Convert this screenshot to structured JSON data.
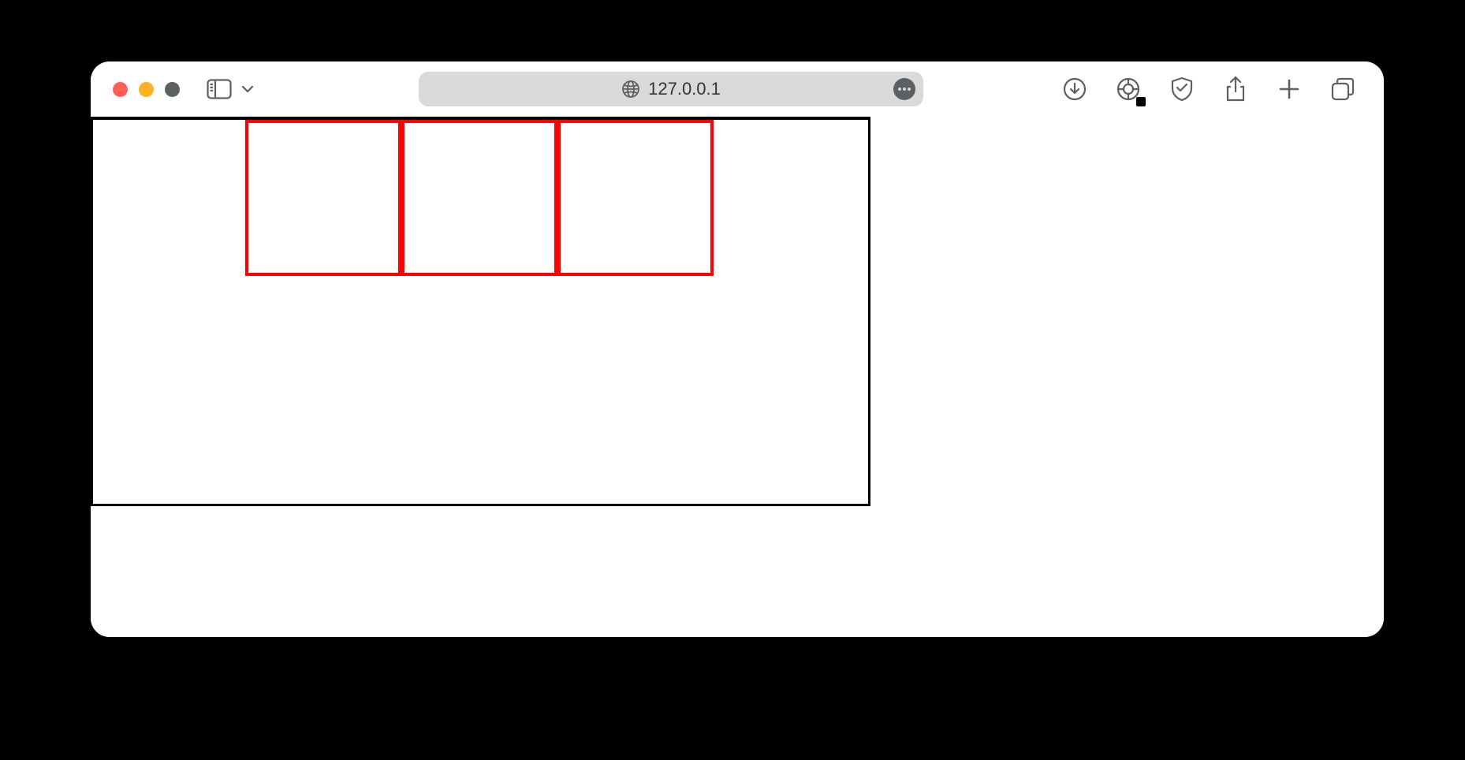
{
  "browser": {
    "address": "127.0.0.1",
    "traffic_lights": {
      "close": "close",
      "minimize": "minimize",
      "maximize": "maximize"
    }
  },
  "content": {
    "black_container": true,
    "red_box_count": 3
  }
}
